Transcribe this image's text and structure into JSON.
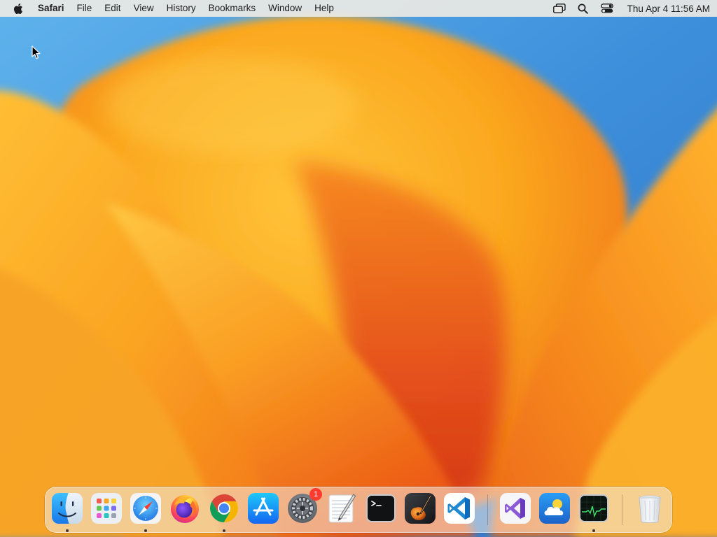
{
  "menubar": {
    "app_name": "Safari",
    "menus": [
      "File",
      "Edit",
      "View",
      "History",
      "Bookmarks",
      "Window",
      "Help"
    ],
    "status_icons": [
      "screen-mirroring-icon",
      "spotlight-search-icon",
      "control-center-icon"
    ],
    "clock": "Thu Apr 4  11:56 AM"
  },
  "dock": {
    "apps": [
      {
        "name": "Finder",
        "icon": "finder-icon",
        "running": true
      },
      {
        "name": "Launchpad",
        "icon": "launchpad-icon",
        "running": false
      },
      {
        "name": "Safari",
        "icon": "safari-icon",
        "running": true
      },
      {
        "name": "Firefox",
        "icon": "firefox-icon",
        "running": false
      },
      {
        "name": "Google Chrome",
        "icon": "chrome-icon",
        "running": true
      },
      {
        "name": "App Store",
        "icon": "app-store-icon",
        "running": false
      },
      {
        "name": "System Settings",
        "icon": "system-settings-icon",
        "running": false,
        "badge": "1"
      },
      {
        "name": "TextEdit",
        "icon": "textedit-icon",
        "running": false
      },
      {
        "name": "Terminal",
        "icon": "terminal-icon",
        "running": false
      },
      {
        "name": "GarageBand",
        "icon": "garageband-icon",
        "running": false
      },
      {
        "name": "Visual Studio Code",
        "icon": "vscode-icon",
        "running": false
      },
      {
        "name": "Visual Studio",
        "icon": "visual-studio-icon",
        "running": false
      },
      {
        "name": "Weather",
        "icon": "weather-icon",
        "running": false
      },
      {
        "name": "Activity Monitor",
        "icon": "activity-monitor-icon",
        "running": true
      },
      {
        "name": "Trash",
        "icon": "trash-icon",
        "running": false
      }
    ]
  },
  "colors": {
    "wallpaper_sky": "#3f8fd8",
    "wallpaper_orange": "#f49a1c",
    "wallpaper_red": "#e04a14",
    "badge_red": "#ff3b30"
  }
}
